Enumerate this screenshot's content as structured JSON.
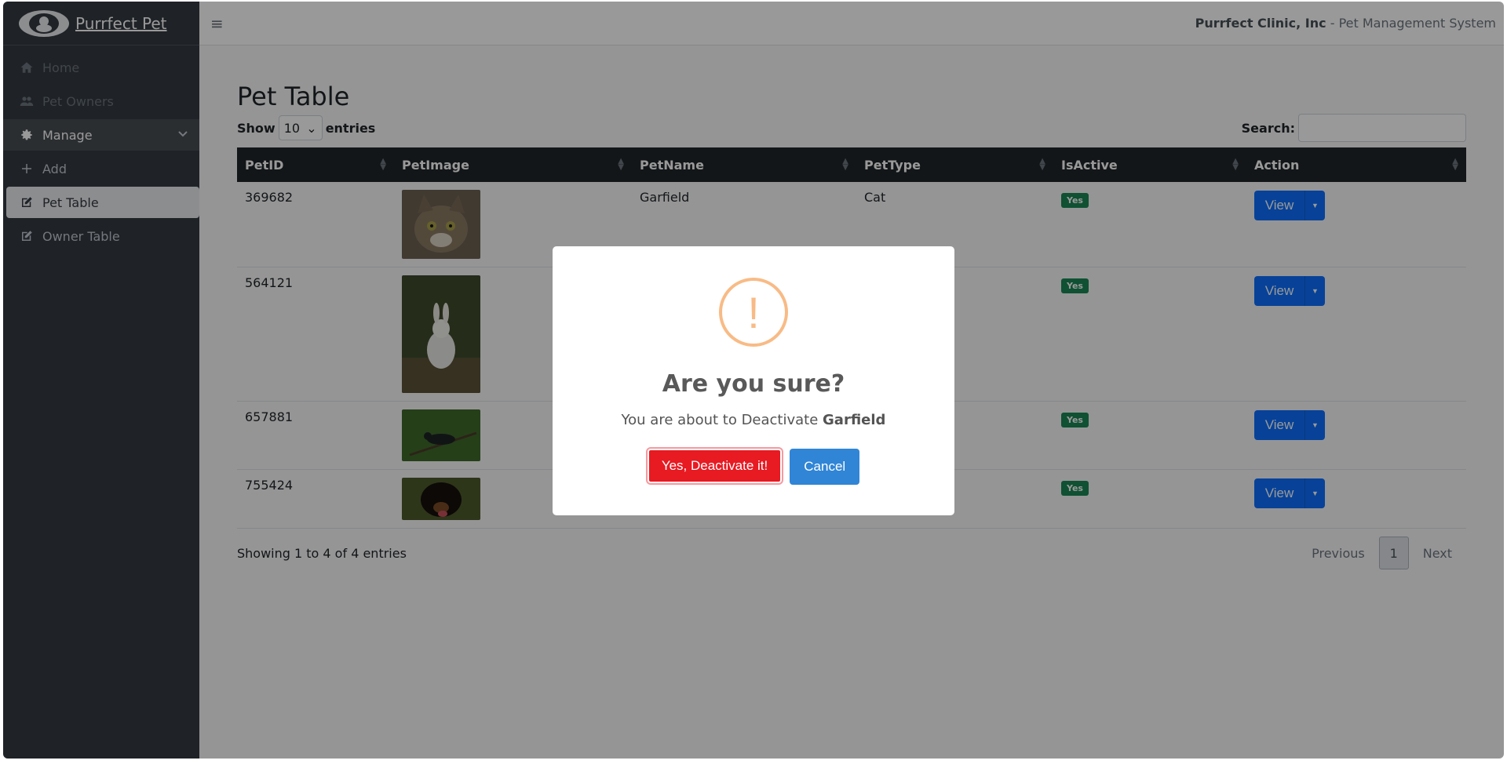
{
  "brand": {
    "name": "Purrfect Pet"
  },
  "sidebar": {
    "items": [
      {
        "label": "Home",
        "icon": "home-icon"
      },
      {
        "label": "Pet Owners",
        "icon": "users-icon"
      },
      {
        "label": "Manage",
        "icon": "gear-icon"
      },
      {
        "label": "Add",
        "icon": "plus-icon"
      },
      {
        "label": "Pet Table",
        "icon": "edit-icon"
      },
      {
        "label": "Owner Table",
        "icon": "edit-icon"
      }
    ]
  },
  "topbar": {
    "menu_icon": "≡",
    "org": "Purrfect Clinic, Inc",
    "separator": " - ",
    "system": "Pet Management System"
  },
  "page": {
    "title": "Pet Table",
    "show_label": "Show",
    "entries_value": "10",
    "entries_label": "entries",
    "search_label": "Search:",
    "search_value": ""
  },
  "table": {
    "headers": [
      "PetID",
      "PetImage",
      "PetName",
      "PetType",
      "IsActive",
      "Action"
    ],
    "rows": [
      {
        "id": "369682",
        "image": "cat",
        "name": "Garfield",
        "type": "Cat",
        "active": "Yes",
        "action": "View"
      },
      {
        "id": "564121",
        "image": "rabbit",
        "name": "",
        "type": "",
        "active": "Yes",
        "action": "View"
      },
      {
        "id": "657881",
        "image": "bird",
        "name": "",
        "type": "",
        "active": "Yes",
        "action": "View"
      },
      {
        "id": "755424",
        "image": "dog",
        "name": "",
        "type": "",
        "active": "Yes",
        "action": "View"
      }
    ],
    "info": "Showing 1 to 4 of 4 entries",
    "pagination": {
      "previous": "Previous",
      "page": "1",
      "next": "Next"
    }
  },
  "modal": {
    "icon": "!",
    "title": "Are you sure?",
    "text_prefix": "You are about to Deactivate ",
    "pet_name": "Garfield",
    "confirm": "Yes, Deactivate it!",
    "cancel": "Cancel"
  },
  "colors": {
    "sidebar": "#343a40",
    "confirm": "#e81a22",
    "cancel": "#3085d6",
    "active_badge": "#198754",
    "view_button": "#0d6efd"
  }
}
